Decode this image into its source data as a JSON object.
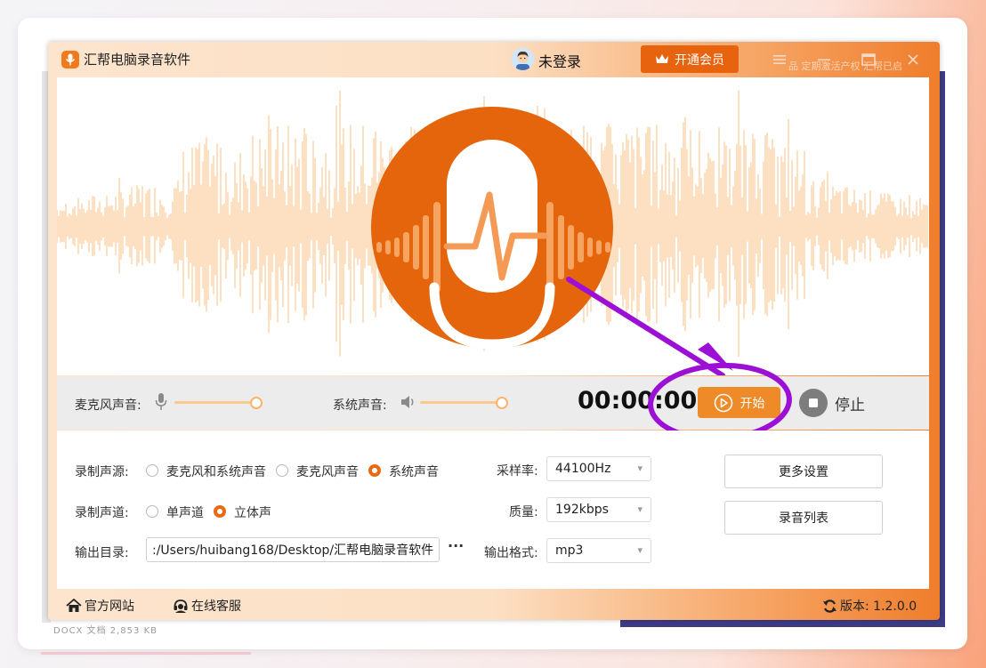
{
  "app": {
    "title": "汇帮电脑录音软件",
    "user_status": "未登录",
    "vip_label": "开通会员",
    "overlay_text": "品 定期激活产权 汇帮已启"
  },
  "background": {
    "bottom_text": "DOCX 文档 2,853 KB"
  },
  "controls": {
    "mic_label": "麦克风声音:",
    "mic_volume": 1.0,
    "system_label": "系统声音:",
    "system_volume": 1.0,
    "timer": "00:00:00",
    "start_label": "开始",
    "stop_label": "停止"
  },
  "settings": {
    "source_label": "录制声源:",
    "source_options": [
      "麦克风和系统声音",
      "麦克风声音",
      "系统声音"
    ],
    "source_selected": 2,
    "channel_label": "录制声道:",
    "channel_options": [
      "单声道",
      "立体声"
    ],
    "channel_selected": 1,
    "output_label": "输出目录:",
    "output_path": ":/Users/huibang168/Desktop/汇帮电脑录音软件",
    "more_label": "···",
    "sample_rate_label": "采样率:",
    "sample_rate": "44100Hz",
    "quality_label": "质量:",
    "quality": "192kbps",
    "format_label": "输出格式:",
    "format": "mp3",
    "more_settings": "更多设置",
    "record_list": "录音列表"
  },
  "footer": {
    "website": "官方网站",
    "service": "在线客服",
    "version": "版本: 1.2.0.0"
  },
  "colors": {
    "accent": "#ee8a28",
    "brand_dark": "#e8630e",
    "wave": "#fcd3a8",
    "arrow": "#9c10d6"
  }
}
